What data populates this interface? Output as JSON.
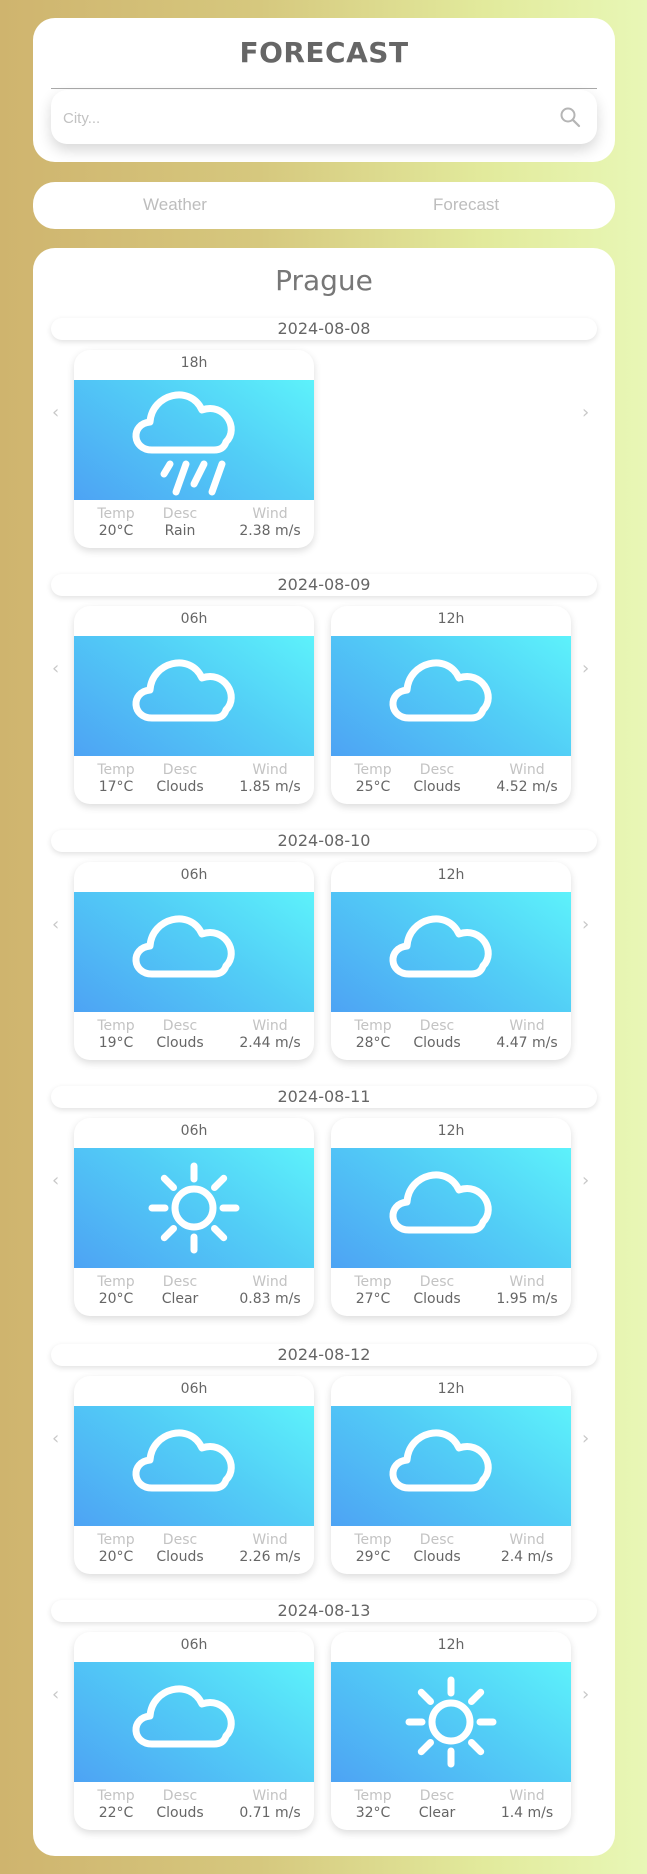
{
  "header": {
    "title": "FORECAST",
    "search_placeholder": "City...",
    "search_icon": "search-icon"
  },
  "tabs": [
    {
      "label": "Weather"
    },
    {
      "label": "Forecast"
    }
  ],
  "city": "Prague",
  "labels": {
    "temp": "Temp",
    "desc": "Desc",
    "wind": "Wind"
  },
  "arrows": {
    "left": "‹",
    "right": "›"
  },
  "days": [
    {
      "date": "2024-08-08",
      "slots": [
        {
          "hour": "18h",
          "icon": "rain-icon",
          "temp": "20°C",
          "desc": "Rain",
          "wind": "2.38 m/s"
        }
      ]
    },
    {
      "date": "2024-08-09",
      "slots": [
        {
          "hour": "06h",
          "icon": "cloud-icon",
          "temp": "17°C",
          "desc": "Clouds",
          "wind": "1.85 m/s"
        },
        {
          "hour": "12h",
          "icon": "cloud-icon",
          "temp": "25°C",
          "desc": "Clouds",
          "wind": "4.52 m/s"
        }
      ]
    },
    {
      "date": "2024-08-10",
      "slots": [
        {
          "hour": "06h",
          "icon": "cloud-icon",
          "temp": "19°C",
          "desc": "Clouds",
          "wind": "2.44 m/s"
        },
        {
          "hour": "12h",
          "icon": "cloud-icon",
          "temp": "28°C",
          "desc": "Clouds",
          "wind": "4.47 m/s"
        }
      ]
    },
    {
      "date": "2024-08-11",
      "slots": [
        {
          "hour": "06h",
          "icon": "sun-icon",
          "temp": "20°C",
          "desc": "Clear",
          "wind": "0.83 m/s"
        },
        {
          "hour": "12h",
          "icon": "cloud-icon",
          "temp": "27°C",
          "desc": "Clouds",
          "wind": "1.95 m/s"
        }
      ]
    },
    {
      "date": "2024-08-12",
      "slots": [
        {
          "hour": "06h",
          "icon": "cloud-icon",
          "temp": "20°C",
          "desc": "Clouds",
          "wind": "2.26 m/s"
        },
        {
          "hour": "12h",
          "icon": "cloud-icon",
          "temp": "29°C",
          "desc": "Clouds",
          "wind": "2.4 m/s"
        }
      ]
    },
    {
      "date": "2024-08-13",
      "slots": [
        {
          "hour": "06h",
          "icon": "cloud-icon",
          "temp": "22°C",
          "desc": "Clouds",
          "wind": "0.71 m/s"
        },
        {
          "hour": "12h",
          "icon": "sun-icon",
          "temp": "32°C",
          "desc": "Clear",
          "wind": "1.4 m/s"
        }
      ]
    }
  ]
}
